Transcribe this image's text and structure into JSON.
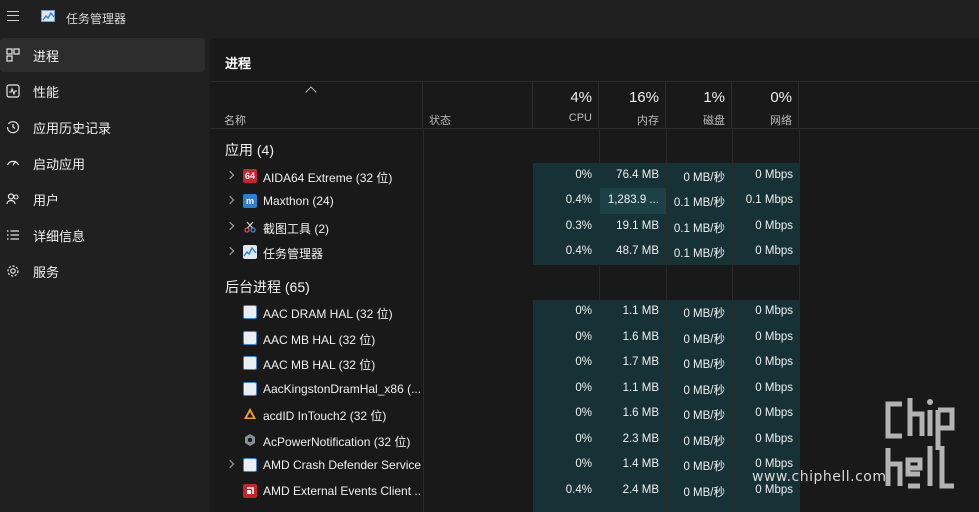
{
  "window": {
    "title": "任务管理器"
  },
  "sidebar": {
    "items": [
      {
        "label": "进程",
        "icon": "processes-icon",
        "active": true
      },
      {
        "label": "性能",
        "icon": "performance-icon",
        "active": false
      },
      {
        "label": "应用历史记录",
        "icon": "app-history-icon",
        "active": false
      },
      {
        "label": "启动应用",
        "icon": "startup-apps-icon",
        "active": false
      },
      {
        "label": "用户",
        "icon": "users-icon",
        "active": false
      },
      {
        "label": "详细信息",
        "icon": "details-icon",
        "active": false
      },
      {
        "label": "服务",
        "icon": "services-icon",
        "active": false
      }
    ]
  },
  "main": {
    "title": "进程",
    "columns": {
      "name": "名称",
      "status": "状态",
      "cpu": {
        "pct": "4%",
        "label": "CPU"
      },
      "memory": {
        "pct": "16%",
        "label": "内存"
      },
      "disk": {
        "pct": "1%",
        "label": "磁盘"
      },
      "network": {
        "pct": "0%",
        "label": "网络"
      }
    },
    "groups": {
      "apps": "应用 (4)",
      "background": "后台进程 (65)"
    },
    "apps": [
      {
        "name": "AIDA64 Extreme (32 位)",
        "icon": "aida64-icon",
        "cpu": "0%",
        "mem": "76.4 MB",
        "disk": "0 MB/秒",
        "net": "0 Mbps"
      },
      {
        "name": "Maxthon (24)",
        "icon": "maxthon-icon",
        "cpu": "0.4%",
        "mem": "1,283.9 ...",
        "disk": "0.1 MB/秒",
        "net": "0.1 Mbps"
      },
      {
        "name": "截图工具 (2)",
        "icon": "snipping-tool-icon",
        "cpu": "0.3%",
        "mem": "19.1 MB",
        "disk": "0.1 MB/秒",
        "net": "0 Mbps"
      },
      {
        "name": "任务管理器",
        "icon": "task-manager-icon",
        "cpu": "0.4%",
        "mem": "48.7 MB",
        "disk": "0.1 MB/秒",
        "net": "0 Mbps"
      }
    ],
    "background": [
      {
        "name": "AAC DRAM HAL (32 位)",
        "icon": "app-window-icon",
        "cpu": "0%",
        "mem": "1.1 MB",
        "disk": "0 MB/秒",
        "net": "0 Mbps"
      },
      {
        "name": "AAC MB HAL (32 位)",
        "icon": "app-window-icon",
        "cpu": "0%",
        "mem": "1.6 MB",
        "disk": "0 MB/秒",
        "net": "0 Mbps"
      },
      {
        "name": "AAC MB HAL (32 位)",
        "icon": "app-window-icon",
        "cpu": "0%",
        "mem": "1.7 MB",
        "disk": "0 MB/秒",
        "net": "0 Mbps"
      },
      {
        "name": "AacKingstonDramHal_x86 (...",
        "icon": "app-window-icon",
        "cpu": "0%",
        "mem": "1.1 MB",
        "disk": "0 MB/秒",
        "net": "0 Mbps"
      },
      {
        "name": "acdID InTouch2 (32 位)",
        "icon": "acdid-icon",
        "cpu": "0%",
        "mem": "1.6 MB",
        "disk": "0 MB/秒",
        "net": "0 Mbps"
      },
      {
        "name": "AcPowerNotification (32 位)",
        "icon": "gear-icon",
        "cpu": "0%",
        "mem": "2.3 MB",
        "disk": "0 MB/秒",
        "net": "0 Mbps"
      },
      {
        "name": "AMD Crash Defender Service",
        "icon": "app-window-icon",
        "cpu": "0%",
        "mem": "1.4 MB",
        "disk": "0 MB/秒",
        "net": "0 Mbps"
      },
      {
        "name": "AMD External Events Client ...",
        "icon": "amd-icon",
        "cpu": "0.4%",
        "mem": "2.4 MB",
        "disk": "0 MB/秒",
        "net": "0 Mbps"
      }
    ]
  },
  "watermark": {
    "text": "www.chiphell.com",
    "logo": "chip hell"
  },
  "colors": {
    "accent_teal": "#173236",
    "hot_teal": "#1c4147",
    "aida_red": "#c4262e",
    "maxthon_blue": "#2f7fd1"
  }
}
